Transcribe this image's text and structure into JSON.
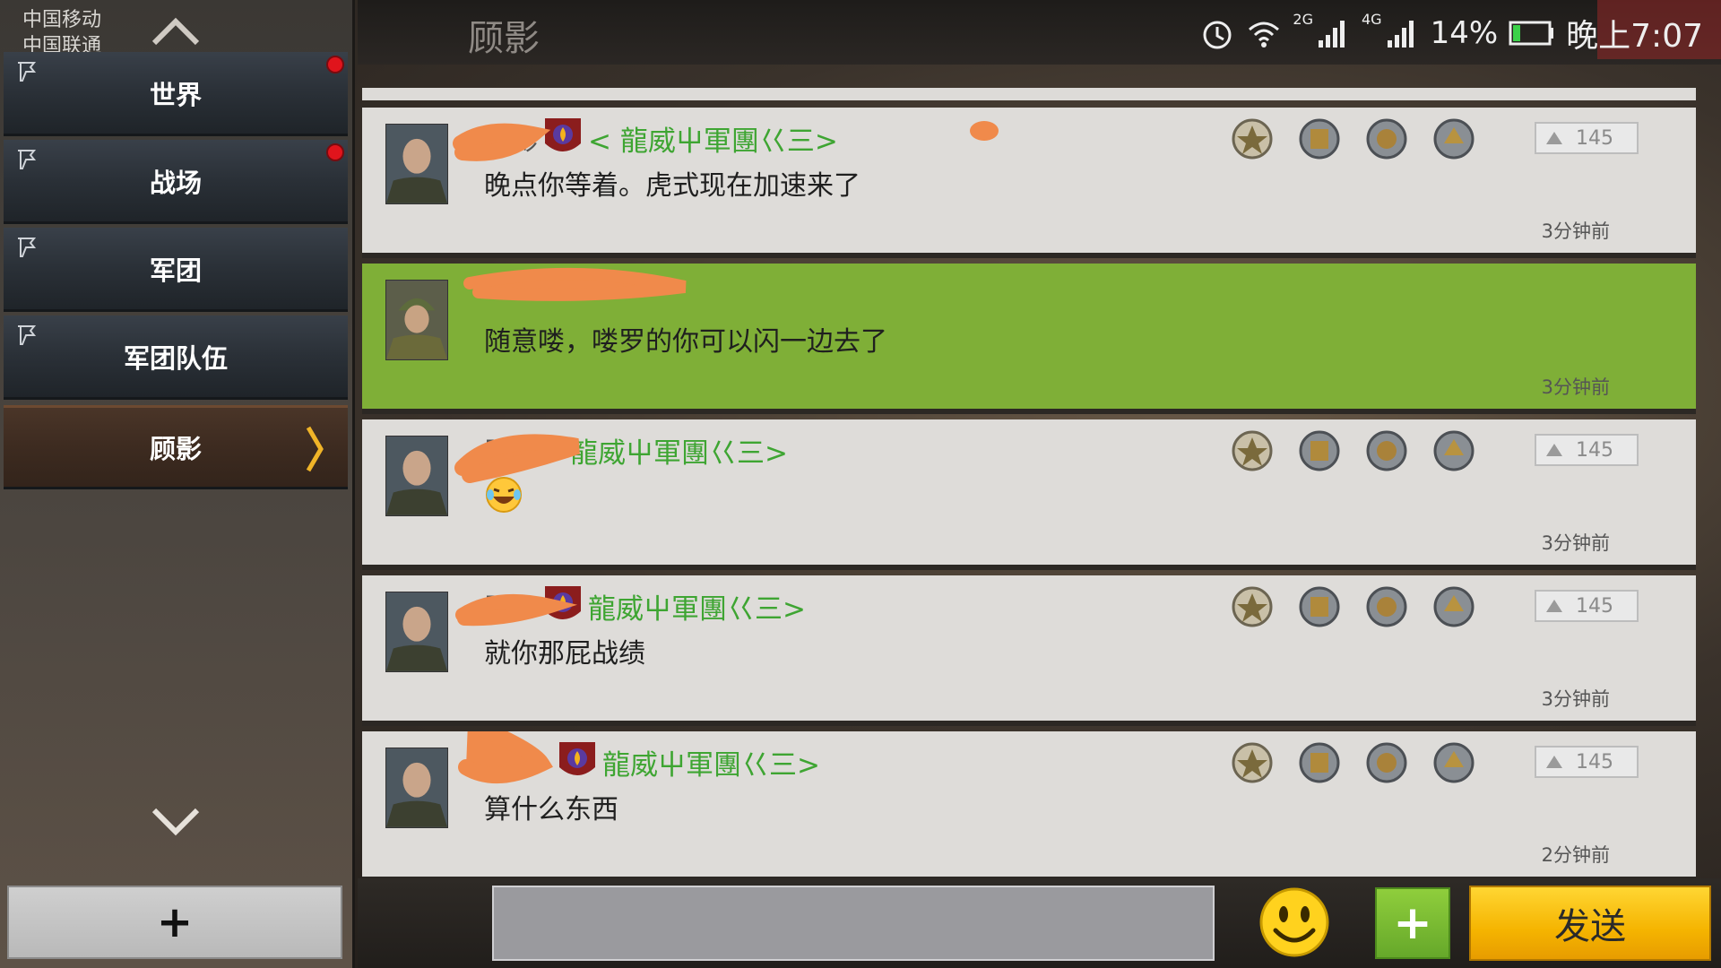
{
  "status_bar": {
    "carrier_1": "中国移动",
    "carrier_2": "中国联通",
    "net_2g": "2G",
    "net_4g": "4G",
    "battery": "14%",
    "time": "晚上7:07"
  },
  "header": {
    "title": "顾影"
  },
  "sidebar": {
    "items": [
      {
        "label": "世界",
        "notification": true
      },
      {
        "label": "战场",
        "notification": true
      },
      {
        "label": "军团",
        "notification": false
      },
      {
        "label": "军团队伍",
        "notification": false
      },
      {
        "label": "顾影",
        "active": true
      }
    ],
    "add_label": "+"
  },
  "messages": [
    {
      "name": "顾影",
      "legion": "< 龍威屮軍團巜三>",
      "text": "晚点你等着。虎式现在加速来了",
      "rank": "145",
      "time": "3分钟前",
      "medals": [
        "medal-1-icon",
        "medal-2-icon",
        "medal-3-icon",
        "medal-4-icon"
      ]
    },
    {
      "name": "",
      "legion": "",
      "text": "随意喽，喽罗的你可以闪一边去了",
      "rank": "",
      "time": "3分钟前",
      "highlight": true
    },
    {
      "name": "顾",
      "legion": "龍威屮軍團巜三>",
      "emoji": "laughing-tears-emoji",
      "rank": "145",
      "time": "3分钟前"
    },
    {
      "name": "顾",
      "legion": "龍威屮軍團巜三>",
      "text": "就你那屁战绩",
      "rank": "145",
      "time": "3分钟前"
    },
    {
      "name": "",
      "legion": "龍威屮軍團巜三>",
      "text": "算什么东西",
      "rank": "145",
      "time": "2分钟前"
    }
  ],
  "input_bar": {
    "input_value": "",
    "attach_label": "+",
    "send_label": "发送"
  },
  "colors": {
    "highlight_green": "#7faf37",
    "legion_green": "#3ea532",
    "send_yellow": "#f5b400",
    "notification_red": "#e0141c"
  }
}
